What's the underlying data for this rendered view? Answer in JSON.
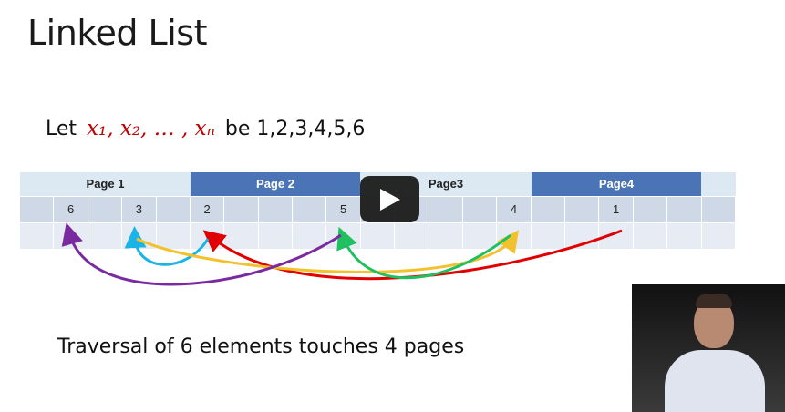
{
  "slide": {
    "title": "Linked List",
    "let_prefix": "Let",
    "let_math": "x₁, x₂, … , xₙ",
    "let_suffix": "be 1,2,3,4,5,6",
    "traversal_text": "Traversal of 6 elements touches 4 pages"
  },
  "pages": [
    {
      "label": "Page 1",
      "style": "light"
    },
    {
      "label": "Page 2",
      "style": "dark"
    },
    {
      "label": "Page3",
      "style": "light"
    },
    {
      "label": "Page4",
      "style": "dark"
    }
  ],
  "cells": [
    "",
    "6",
    "",
    "3",
    "",
    "2",
    "",
    "",
    "",
    "5",
    "",
    "",
    "",
    "",
    "4",
    "",
    "",
    "1",
    "",
    "",
    ""
  ],
  "links": [
    {
      "from": "1",
      "to": "2",
      "color": "#e00000"
    },
    {
      "from": "2",
      "to": "3",
      "color": "#1ab4e6"
    },
    {
      "from": "3",
      "to": "4",
      "color": "#f2c12e"
    },
    {
      "from": "4",
      "to": "5",
      "color": "#20c060"
    },
    {
      "from": "5",
      "to": "6",
      "color": "#7a2aa0"
    }
  ],
  "colors": {
    "page_dark": "#4a74b6",
    "page_light": "#dce9f3",
    "math_red": "#c00000"
  },
  "player": {
    "play_icon": "play-icon"
  },
  "webcam": {
    "description_icon": "presenter-video"
  }
}
